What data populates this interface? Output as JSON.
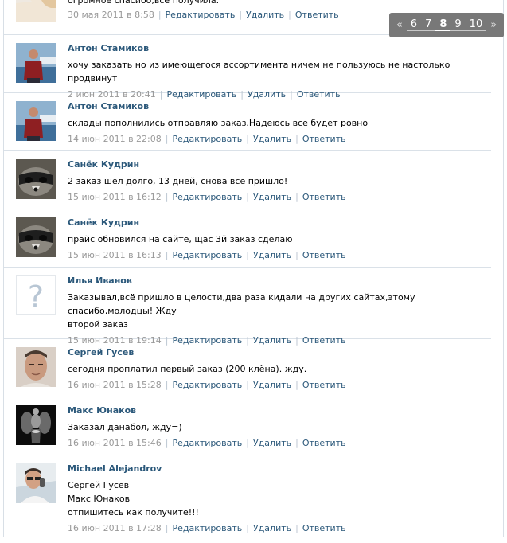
{
  "pager": {
    "prev": "«",
    "pages": [
      "6",
      "7",
      "8",
      "9",
      "10"
    ],
    "current": "8",
    "next": "»"
  },
  "actions": {
    "edit": "Редактировать",
    "delete": "Удалить",
    "reply": "Ответить",
    "separator": "|"
  },
  "posts": [
    {
      "author": "",
      "text": "огромное спасибо,все получила.",
      "date": "30 мая 2011 в 8:58",
      "avatar": "user-photo"
    },
    {
      "author": "Антон Стамиков",
      "text": "хочу заказать но из имеющегося ассортимента ничем не пользуюсь не настолько продвинут",
      "date": "2 июн 2011 в 20:41",
      "avatar": "man-on-boat-photo"
    },
    {
      "author": "Антон Стамиков",
      "text": "склады пополнились отправляю заказ.Надеюсь все будет ровно",
      "date": "14 июн 2011 в 22:08",
      "avatar": "man-on-boat-photo"
    },
    {
      "author": "Санёк Кудрин",
      "text": "2 заказ шёл долго, 13 дней, снова всё пришло!",
      "date": "15 июн 2011 в 16:12",
      "avatar": "raccoon-photo"
    },
    {
      "author": "Санёк Кудрин",
      "text": "прайс обновился на сайте, щас 3й заказ сделаю",
      "date": "15 июн 2011 в 16:13",
      "avatar": "raccoon-photo"
    },
    {
      "author": "Илья Иванов",
      "text": "Заказывал,всё пришло в целости,два раза кидали на других сайтах,этому спасибо,молодцы! Жду\nвторой заказ",
      "date": "15 июн 2011 в 19:14",
      "avatar": "question-mark-placeholder"
    },
    {
      "author": "Сергей Гусев",
      "text": "сегодня проплатил первый заказ (200 клёна). жду.",
      "date": "16 июн 2011 в 15:28",
      "avatar": "man-portrait-photo"
    },
    {
      "author": "Макс Юнаков",
      "text": "Заказал данабол, жду=)",
      "date": "16 июн 2011 в 15:46",
      "avatar": "bodybuilder-photo"
    },
    {
      "author": "Michael Alejandrov",
      "text": "Сергей Гусев\nМакс Юнаков\nотпишитесь как получите!!!",
      "date": "16 июн 2011 в 17:28",
      "avatar": "man-with-phone-photo"
    }
  ]
}
